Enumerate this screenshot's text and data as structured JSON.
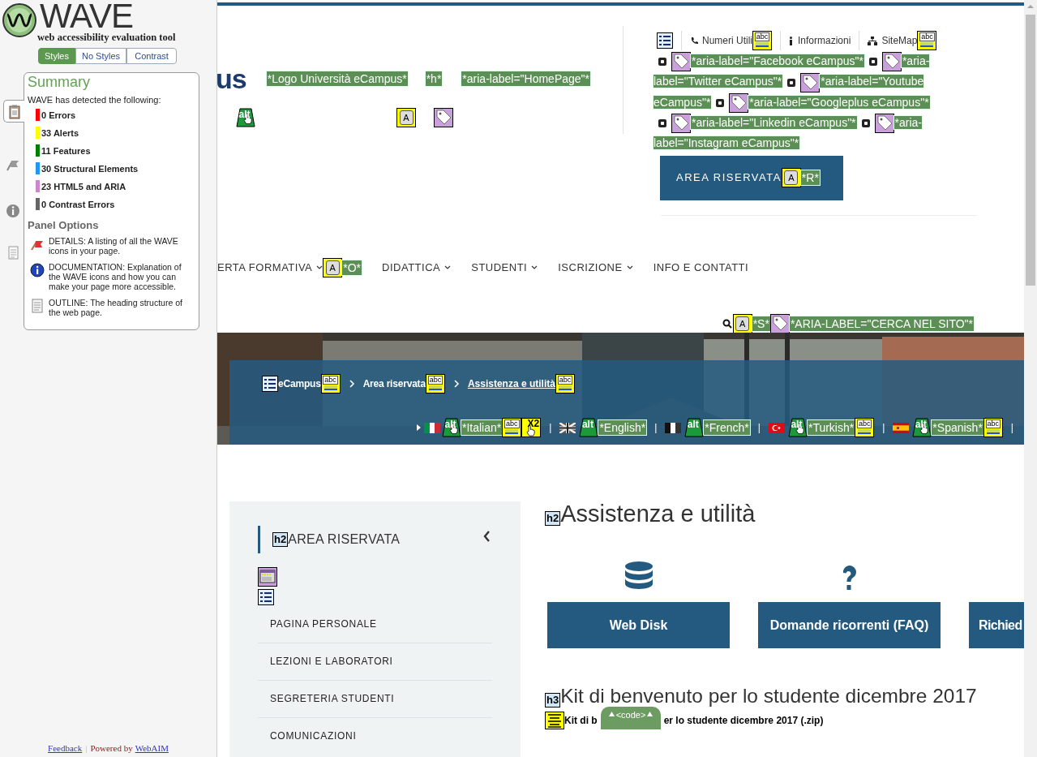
{
  "wave": {
    "title": "WAVE",
    "tagline": "web accessibility evaluation tool",
    "view_tabs": [
      {
        "label": "Styles",
        "selected": true
      },
      {
        "label": "No Styles",
        "selected": false
      },
      {
        "label": "Contrast",
        "selected": false
      }
    ],
    "side_tabs": [
      {
        "kind": "clipboard",
        "selected": true
      },
      {
        "kind": "flag",
        "selected": false
      },
      {
        "kind": "info",
        "selected": false
      },
      {
        "kind": "outline",
        "selected": false
      }
    ],
    "summary": {
      "title": "Summary",
      "intro": "WAVE has detected the following:",
      "counts": [
        {
          "label": "0 Errors",
          "color": "#ff0000"
        },
        {
          "label": "33 Alerts",
          "color": "#ffff00"
        },
        {
          "label": "11 Features",
          "color": "#008000"
        },
        {
          "label": "30 Structural Elements",
          "color": "#2196f3"
        },
        {
          "label": "23 HTML5 and ARIA",
          "color": "#cc88cc"
        },
        {
          "label": "0 Contrast Errors",
          "color": "#666666"
        }
      ],
      "options_title": "Panel Options",
      "options": [
        {
          "kind": "details",
          "text": "DETAILS: A listing of all the WAVE icons in your page."
        },
        {
          "kind": "documentation",
          "text": "DOCUMENTATION: Explanation of the WAVE icons and how you can make your page more accessible."
        },
        {
          "kind": "outline",
          "text": "OUTLINE: The heading structure of the web page."
        }
      ]
    },
    "footer": {
      "feedback": "Feedback",
      "separator": "|",
      "powered": "Powered by",
      "webaim": "WebAIM"
    }
  },
  "page": {
    "logo_fragment": "us",
    "logo_labels": [
      {
        "kind": "label",
        "text": "*Logo Università eCampus*"
      },
      {
        "kind": "label",
        "text": "*h*"
      },
      {
        "kind": "label",
        "text": "*aria-label=\"HomePage\"*"
      }
    ],
    "logo_marks": [
      {
        "kind": "alt",
        "text": "alt",
        "linked": true
      },
      {
        "kind": "accesskey",
        "text": "A"
      },
      {
        "kind": "aria"
      }
    ],
    "top_links": [
      {
        "kind": "list"
      },
      {
        "kind": "sep"
      },
      {
        "kind": "phone"
      },
      {
        "kind": "text",
        "text": "Numeri Utili"
      },
      {
        "kind": "abc",
        "text": "abc"
      },
      {
        "kind": "sep"
      },
      {
        "kind": "info"
      },
      {
        "kind": "text",
        "text": "Informazioni"
      },
      {
        "kind": "sep"
      },
      {
        "kind": "sitemap"
      },
      {
        "kind": "text",
        "text": "SiteMap"
      },
      {
        "kind": "abc",
        "text": "abc"
      }
    ],
    "social": [
      {
        "kind": "social"
      },
      {
        "kind": "aria"
      },
      {
        "kind": "label",
        "text": "*aria-label=\"Facebook eCampus\"*"
      },
      {
        "kind": "social"
      },
      {
        "kind": "aria"
      },
      {
        "kind": "label",
        "text": "*aria-label=\"Twitter eCampus\"*"
      },
      {
        "kind": "social"
      },
      {
        "kind": "aria"
      },
      {
        "kind": "label",
        "text": "*aria-label=\"Youtube eCampus\"*"
      },
      {
        "kind": "social"
      },
      {
        "kind": "aria"
      },
      {
        "kind": "label",
        "text": "*aria-label=\"Googleplus eCampus\"*"
      },
      {
        "kind": "social"
      },
      {
        "kind": "aria"
      },
      {
        "kind": "label",
        "text": "*aria-label=\"Linkedin eCampus\"*"
      },
      {
        "kind": "social"
      },
      {
        "kind": "aria"
      },
      {
        "kind": "label",
        "text": "*aria-label=\"Instagram eCampus\"*"
      }
    ],
    "reserved_button": {
      "label": "AREA RISERVATA",
      "marks": [
        {
          "kind": "accesskey",
          "text": "A"
        },
        {
          "kind": "label",
          "text": "*R*"
        }
      ]
    },
    "nav": [
      {
        "label": "ERTA FORMATIVA",
        "caret": true,
        "marks": [
          {
            "kind": "accesskey",
            "text": "A"
          },
          {
            "kind": "label",
            "text": "*O*"
          }
        ]
      },
      {
        "label": "DIDATTICA",
        "caret": true
      },
      {
        "label": "STUDENTI",
        "caret": true
      },
      {
        "label": "ISCRIZIONE",
        "caret": true
      },
      {
        "label": "INFO E CONTATTI",
        "caret": false
      }
    ],
    "search": [
      {
        "kind": "search"
      },
      {
        "kind": "accesskey",
        "text": "A"
      },
      {
        "kind": "label",
        "text": "*S*"
      },
      {
        "kind": "aria"
      },
      {
        "kind": "label",
        "text": "*ARIA-LABEL=\"CERCA NEL SITO\"*"
      }
    ],
    "hero": {
      "kind": "picture",
      "breadcrumb": [
        {
          "kind": "list"
        },
        {
          "kind": "crumb",
          "text": "eCampus"
        },
        {
          "kind": "abc",
          "text": "abc"
        },
        {
          "kind": "chevron"
        },
        {
          "kind": "crumb",
          "text": "Area riservata"
        },
        {
          "kind": "abc",
          "text": "abc"
        },
        {
          "kind": "chevron"
        },
        {
          "kind": "current",
          "text": "Assistenza e utilità"
        },
        {
          "kind": "abc",
          "text": "abc"
        }
      ],
      "languages": [
        {
          "kind": "arrow"
        },
        {
          "kind": "flag_it"
        },
        {
          "kind": "alt",
          "text": "alt",
          "linked": true
        },
        {
          "kind": "label",
          "text": "*Italian*"
        },
        {
          "kind": "abc",
          "text": "abc"
        },
        {
          "kind": "x2",
          "text": "X2"
        },
        {
          "kind": "bar",
          "text": "|"
        },
        {
          "kind": "flag_gb"
        },
        {
          "kind": "alt",
          "text": "alt",
          "linked": false
        },
        {
          "kind": "label",
          "text": "*English*"
        },
        {
          "kind": "bar",
          "text": "|"
        },
        {
          "kind": "flag_fr"
        },
        {
          "kind": "alt",
          "text": "alt",
          "linked": false
        },
        {
          "kind": "label",
          "text": "*French*"
        },
        {
          "kind": "bar",
          "text": "|"
        },
        {
          "kind": "flag_tr"
        },
        {
          "kind": "alt",
          "text": "alt",
          "linked": true
        },
        {
          "kind": "label",
          "text": "*Turkish*"
        },
        {
          "kind": "abc",
          "text": "abc"
        },
        {
          "kind": "bar",
          "text": "|"
        },
        {
          "kind": "flag_es"
        },
        {
          "kind": "alt",
          "text": "alt",
          "linked": true
        },
        {
          "kind": "label",
          "text": "*Spanish*"
        },
        {
          "kind": "abc",
          "text": "abc"
        },
        {
          "kind": "bar",
          "text": "|"
        }
      ]
    },
    "side_menu": {
      "heading_tag": "h2",
      "heading": "AREA RISERVATA",
      "items": [
        "PAGINA PERSONALE",
        "LEZIONI E LABORATORI",
        "SEGRETERIA STUDENTI",
        "COMUNICAZIONI"
      ]
    },
    "main": {
      "heading_tag": "h2",
      "heading": "Assistenza e utilità",
      "cards": [
        {
          "kind": "database",
          "label": "Web Disk"
        },
        {
          "kind": "question",
          "label": "Domande ricorrenti (FAQ)"
        },
        {
          "kind": "none",
          "label": "Richied"
        }
      ],
      "subheading_tag": "h3",
      "subheading": "Kit di benvenuto per lo studente dicembre 2017",
      "file_link": [
        "Kit di b",
        "er lo studente dicembre 2017 (.zip)"
      ],
      "code_toggle": "<code>"
    }
  }
}
